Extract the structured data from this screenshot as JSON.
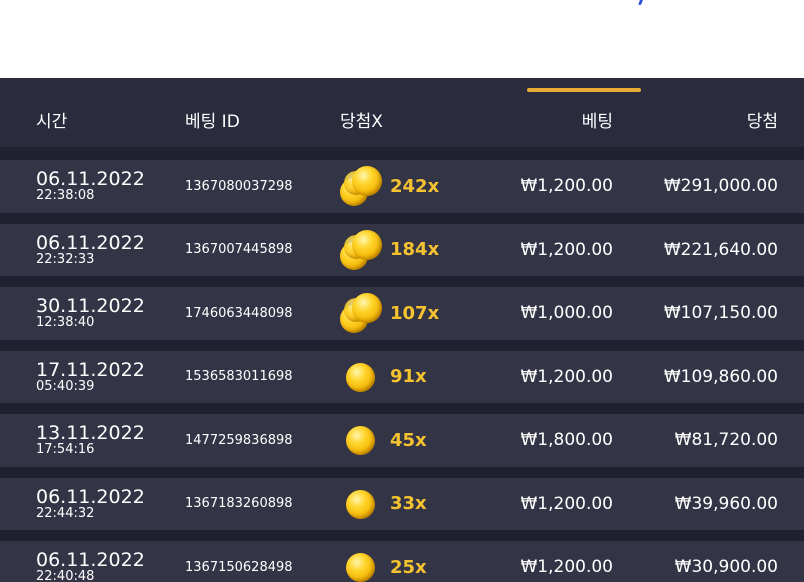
{
  "columns": {
    "time": "시간",
    "bet_id": "베팅 ID",
    "multiplier": "당첨X",
    "bet": "베팅",
    "win": "당첨"
  },
  "rows": [
    {
      "date": "06.11.2022",
      "time": "22:38:08",
      "bet_id": "1367080037298",
      "coin_icon": "coin-stack-icon",
      "multiplier": "242x",
      "bet": "₩1,200.00",
      "win": "₩291,000.00"
    },
    {
      "date": "06.11.2022",
      "time": "22:32:33",
      "bet_id": "1367007445898",
      "coin_icon": "coin-stack-icon",
      "multiplier": "184x",
      "bet": "₩1,200.00",
      "win": "₩221,640.00"
    },
    {
      "date": "30.11.2022",
      "time": "12:38:40",
      "bet_id": "1746063448098",
      "coin_icon": "coin-stack-icon",
      "multiplier": "107x",
      "bet": "₩1,000.00",
      "win": "₩107,150.00"
    },
    {
      "date": "17.11.2022",
      "time": "05:40:39",
      "bet_id": "1536583011698",
      "coin_icon": "coin-icon",
      "multiplier": "91x",
      "bet": "₩1,200.00",
      "win": "₩109,860.00"
    },
    {
      "date": "13.11.2022",
      "time": "17:54:16",
      "bet_id": "1477259836898",
      "coin_icon": "coin-icon",
      "multiplier": "45x",
      "bet": "₩1,800.00",
      "win": "₩81,720.00"
    },
    {
      "date": "06.11.2022",
      "time": "22:44:32",
      "bet_id": "1367183260898",
      "coin_icon": "coin-icon",
      "multiplier": "33x",
      "bet": "₩1,200.00",
      "win": "₩39,960.00"
    },
    {
      "date": "06.11.2022",
      "time": "22:40:48",
      "bet_id": "1367150628498",
      "coin_icon": "coin-icon",
      "multiplier": "25x",
      "bet": "₩1,200.00",
      "win": "₩30,900.00"
    }
  ],
  "colors": {
    "panel_bg": "#1f2030",
    "header_bg": "#2a2b3d",
    "row_bg": "#333445",
    "accent": "#e8ac35",
    "multiplier_text": "#f5c230"
  }
}
